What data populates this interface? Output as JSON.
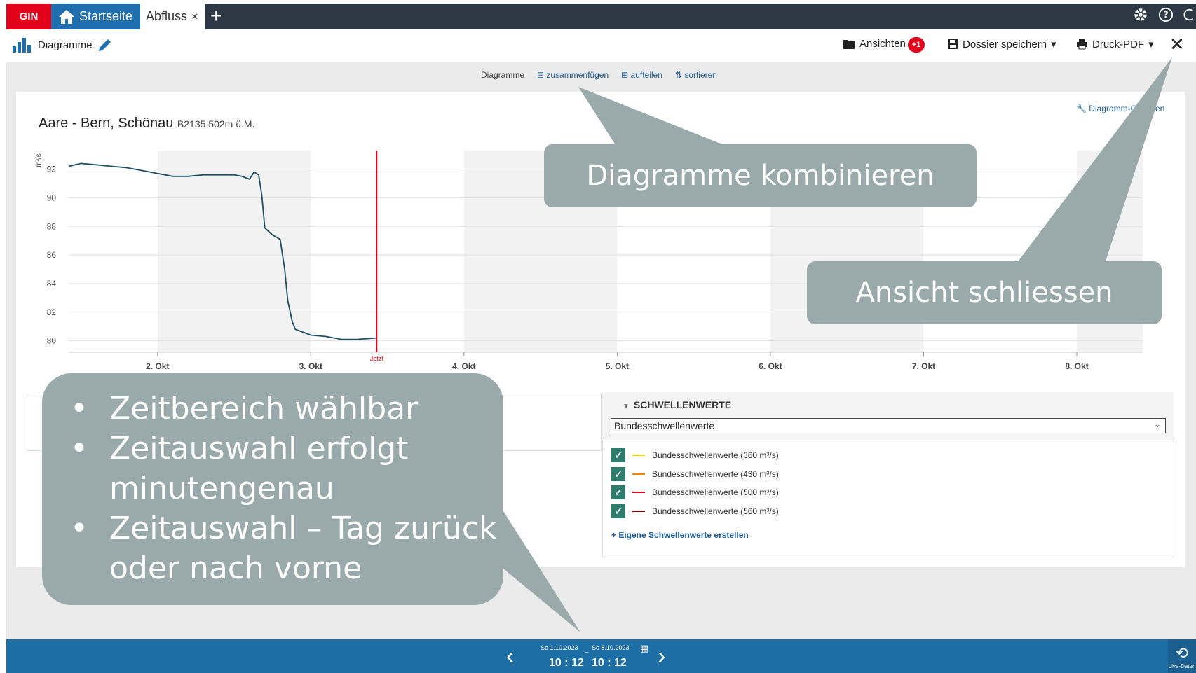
{
  "app": {
    "logo": "GIN",
    "colors": {
      "brand_red": "#e2001a",
      "accent_blue": "#1f6fae",
      "series_blue": "#1d4e63",
      "now_line": "#e2001a"
    }
  },
  "tabs": {
    "home": "Startseite",
    "active": "Abfluss",
    "close_glyph": "×",
    "add_glyph": "+"
  },
  "header": {
    "title": "Diagramme",
    "views": "Ansichten",
    "views_badge": "+1",
    "save": "Dossier speichern",
    "print": "Druck-PDF"
  },
  "subbar": {
    "label": "Diagramme",
    "merge": "zusammenfügen",
    "split": "aufteilen",
    "sort": "sortieren"
  },
  "chart_card": {
    "title": "Aare - Bern, Schönau",
    "subtitle": "B2135 502m ü.M.",
    "options": "Diagramm-Optionen"
  },
  "chart_data": {
    "type": "line",
    "ylabel": "m³/s",
    "ylim": [
      79.2,
      93.3
    ],
    "yticks": [
      80,
      82,
      84,
      86,
      88,
      90,
      92
    ],
    "x_ticks": [
      "2. Okt",
      "3. Okt",
      "4. Okt",
      "5. Okt",
      "6. Okt",
      "7. Okt",
      "8. Okt"
    ],
    "xlim_days": [
      1.42,
      8.43
    ],
    "now_label": "Jetzt",
    "now_day": 3.43,
    "series": [
      {
        "values_day": [
          1.42,
          1.5,
          1.6,
          1.7,
          1.8,
          1.9,
          2.0,
          2.1,
          2.2,
          2.3,
          2.4,
          2.5,
          2.55,
          2.6,
          2.63,
          2.66,
          2.68,
          2.7,
          2.75,
          2.8,
          2.83,
          2.85,
          2.88,
          2.9,
          2.95,
          3.0,
          3.1,
          3.2,
          3.3,
          3.43
        ],
        "values": [
          92.2,
          92.4,
          92.3,
          92.2,
          92.1,
          91.9,
          91.7,
          91.5,
          91.5,
          91.6,
          91.6,
          91.6,
          91.5,
          91.3,
          91.8,
          91.6,
          90.2,
          87.9,
          87.4,
          87.1,
          85.0,
          82.8,
          81.3,
          80.8,
          80.6,
          80.4,
          80.3,
          80.1,
          80.1,
          80.2
        ]
      }
    ]
  },
  "thresholds": {
    "heading": "SCHWELLENWERTE",
    "select_value": "Bundesschwellenwerte",
    "items": [
      {
        "label": "Bundesschwellenwerte (360 m³/s)",
        "color": "#f2d600"
      },
      {
        "label": "Bundesschwellenwerte (430 m³/s)",
        "color": "#f08a00"
      },
      {
        "label": "Bundesschwellenwerte (500 m³/s)",
        "color": "#e2001a"
      },
      {
        "label": "Bundesschwellenwerte (560 m³/s)",
        "color": "#8b0000"
      }
    ],
    "add": "+ Eigene Schwellenwerte erstellen"
  },
  "timebar": {
    "from_date": "So 1.10.2023",
    "to_date": "So 8.10.2023",
    "separator": "_",
    "from_time": "10 : 12",
    "to_time": "10 : 12",
    "live": "Live-Daten"
  },
  "callouts": {
    "combine": "Diagramme kombinieren",
    "close_view": "Ansicht schliessen",
    "bullets": [
      "Zeitbereich wählbar",
      "Zeitauswahl erfolgt minutengenau",
      "Zeitauswahl – Tag zurück oder nach vorne"
    ]
  }
}
